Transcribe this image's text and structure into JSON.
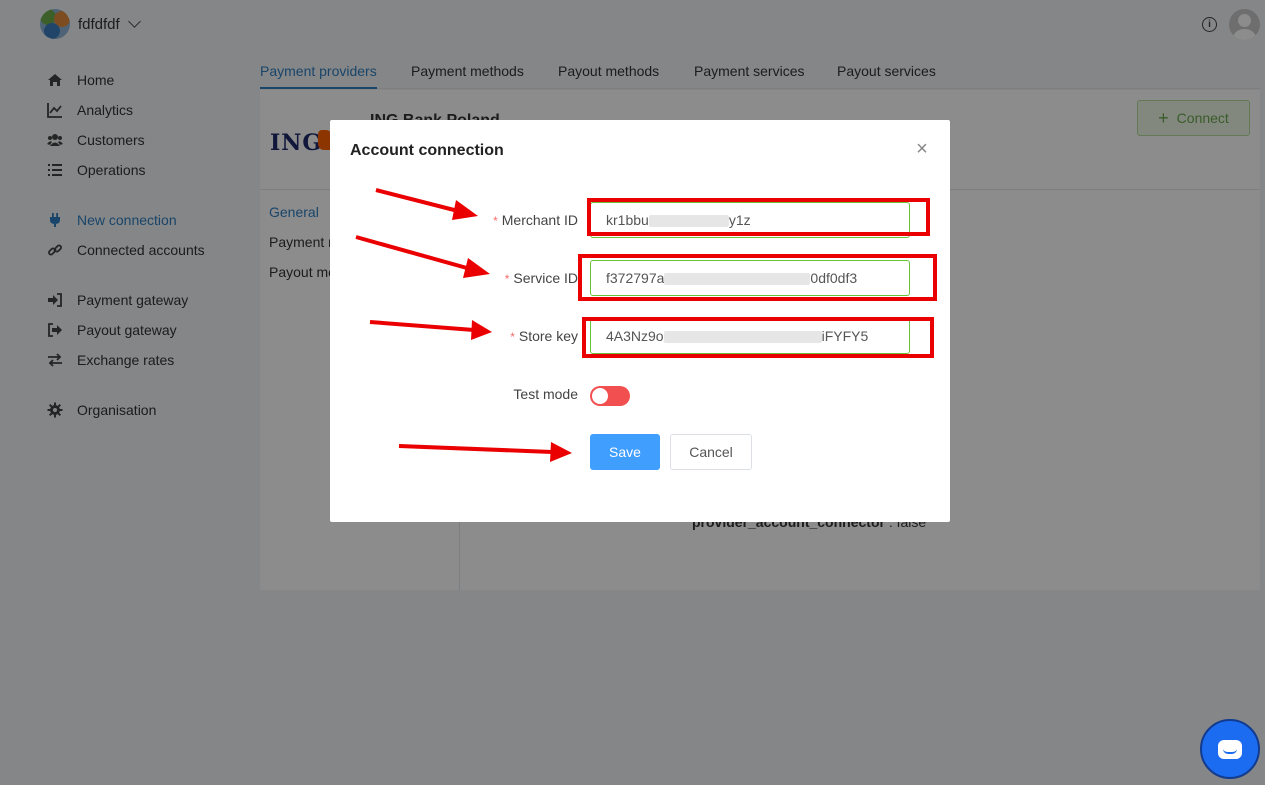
{
  "org": {
    "name": "fdfdfdf"
  },
  "sidebar": {
    "items": [
      {
        "label": "Home",
        "icon": "home-icon"
      },
      {
        "label": "Analytics",
        "icon": "chart-icon"
      },
      {
        "label": "Customers",
        "icon": "users-icon"
      },
      {
        "label": "Operations",
        "icon": "list-icon"
      },
      {
        "label": "New connection",
        "icon": "plug-icon",
        "active": true
      },
      {
        "label": "Connected accounts",
        "icon": "link-icon"
      },
      {
        "label": "Payment gateway",
        "icon": "sign-in-icon"
      },
      {
        "label": "Payout gateway",
        "icon": "sign-out-icon"
      },
      {
        "label": "Exchange rates",
        "icon": "exchange-icon"
      },
      {
        "label": "Organisation",
        "icon": "gear-icon"
      }
    ]
  },
  "tabs": [
    "Payment providers",
    "Payment methods",
    "Payout methods",
    "Payment services",
    "Payout services"
  ],
  "provider": {
    "logo_text": "ING",
    "title": "ING Bank Poland",
    "connect_label": "Connect"
  },
  "side_tabs": [
    "General",
    "Payment m",
    "Payout me"
  ],
  "property": {
    "key": "provider_account_connector",
    "value": ": false"
  },
  "modal": {
    "title": "Account connection",
    "fields": [
      {
        "label": "Merchant ID",
        "prefix": "kr1bbu",
        "suffix": "y1z"
      },
      {
        "label": "Service ID",
        "prefix": "f372797a",
        "suffix": "0df0df3"
      },
      {
        "label": "Store key",
        "prefix": "4A3Nz9o",
        "suffix": "iFYFY5"
      }
    ],
    "test_mode_label": "Test mode",
    "test_mode_on": true,
    "save_label": "Save",
    "cancel_label": "Cancel"
  },
  "colors": {
    "primary": "#409eff",
    "accent_blue": "#2f7fc1",
    "valid_border": "#67c23a",
    "required": "#f56c6c",
    "toggle": "#f25050",
    "annotation": "#ea0000",
    "chat": "#1b6cf0"
  }
}
